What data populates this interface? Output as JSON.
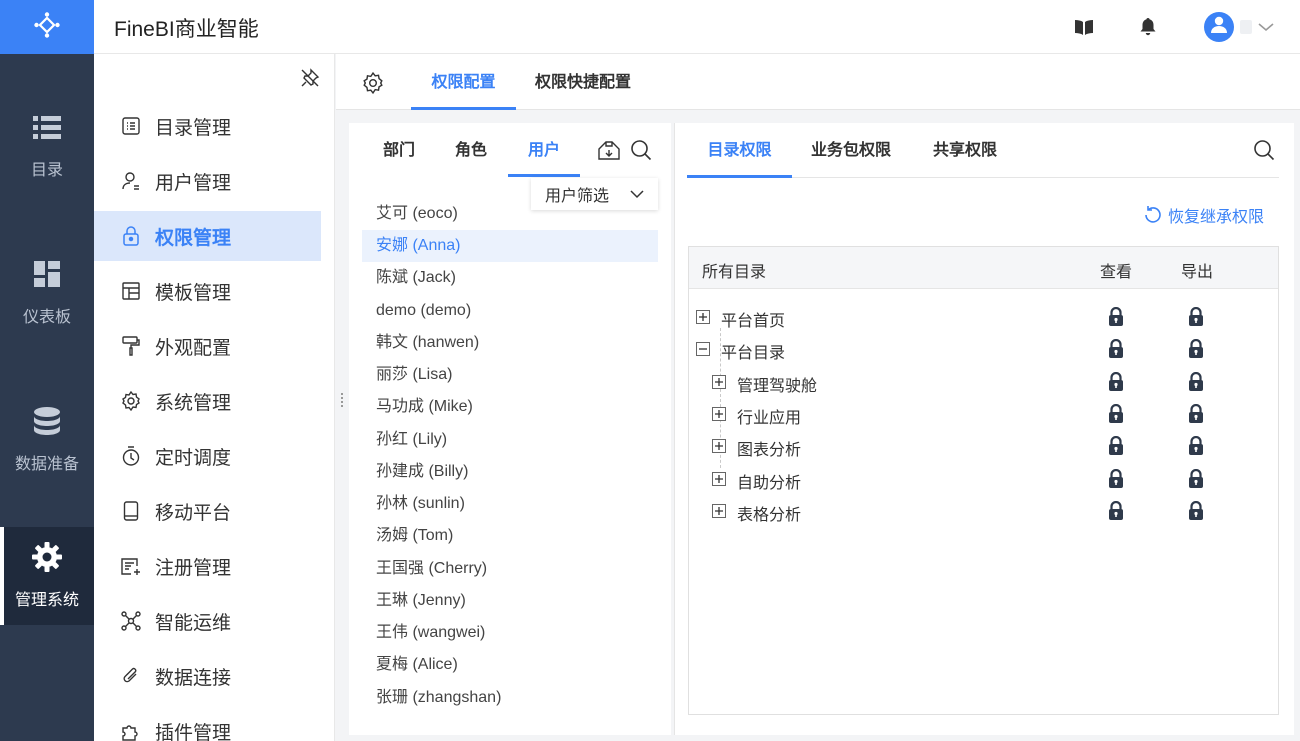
{
  "header": {
    "app_title": "FineBI商业智能"
  },
  "rail": {
    "items": [
      {
        "label": "目录",
        "icon": "list-icon"
      },
      {
        "label": "仪表板",
        "icon": "dashboard-icon"
      },
      {
        "label": "数据准备",
        "icon": "database-icon"
      },
      {
        "label": "管理系统",
        "icon": "gear-icon",
        "active": true
      }
    ]
  },
  "sidebar": {
    "items": [
      {
        "label": "目录管理",
        "icon": "catalog-icon"
      },
      {
        "label": "用户管理",
        "icon": "user-icon"
      },
      {
        "label": "权限管理",
        "icon": "lock-icon",
        "active": true
      },
      {
        "label": "模板管理",
        "icon": "template-icon"
      },
      {
        "label": "外观配置",
        "icon": "paint-roller-icon"
      },
      {
        "label": "系统管理",
        "icon": "settings-icon"
      },
      {
        "label": "定时调度",
        "icon": "timer-icon"
      },
      {
        "label": "移动平台",
        "icon": "mobile-icon"
      },
      {
        "label": "注册管理",
        "icon": "register-icon"
      },
      {
        "label": "智能运维",
        "icon": "network-icon"
      },
      {
        "label": "数据连接",
        "icon": "paperclip-icon"
      },
      {
        "label": "插件管理",
        "icon": "plugin-icon"
      }
    ]
  },
  "tabs": {
    "items": [
      "权限配置",
      "权限快捷配置"
    ],
    "active_index": 0
  },
  "users_panel": {
    "tabs": [
      "部门",
      "角色",
      "用户"
    ],
    "active_tab": 2,
    "filter_label": "用户筛选",
    "users": [
      "艾可 (eoco)",
      "安娜 (Anna)",
      "陈斌 (Jack)",
      "demo (demo)",
      "韩文 (hanwen)",
      "丽莎 (Lisa)",
      "马功成 (Mike)",
      "孙红 (Lily)",
      "孙建成 (Billy)",
      "孙林 (sunlin)",
      "汤姆 (Tom)",
      "王国强 (Cherry)",
      "王琳 (Jenny)",
      "王伟 (wangwei)",
      "夏梅 (Alice)",
      "张珊 (zhangshan)"
    ],
    "selected_user": 1
  },
  "perm_panel": {
    "tabs": [
      "目录权限",
      "业务包权限",
      "共享权限"
    ],
    "active_tab": 0,
    "restore_label": "恢复继承权限",
    "columns": {
      "name": "所有目录",
      "view": "查看",
      "export": "导出"
    },
    "tree": [
      {
        "label": "平台首页",
        "level": 0,
        "expanded": false
      },
      {
        "label": "平台目录",
        "level": 0,
        "expanded": true
      },
      {
        "label": "管理驾驶舱",
        "level": 1,
        "expanded": false
      },
      {
        "label": "行业应用",
        "level": 1,
        "expanded": false
      },
      {
        "label": "图表分析",
        "level": 1,
        "expanded": false
      },
      {
        "label": "自助分析",
        "level": 1,
        "expanded": false
      },
      {
        "label": "表格分析",
        "level": 1,
        "expanded": false
      }
    ]
  },
  "colors": {
    "accent": "#3b82f6",
    "rail_bg": "#2d3a4f",
    "active_bg": "#dbe7fb"
  }
}
